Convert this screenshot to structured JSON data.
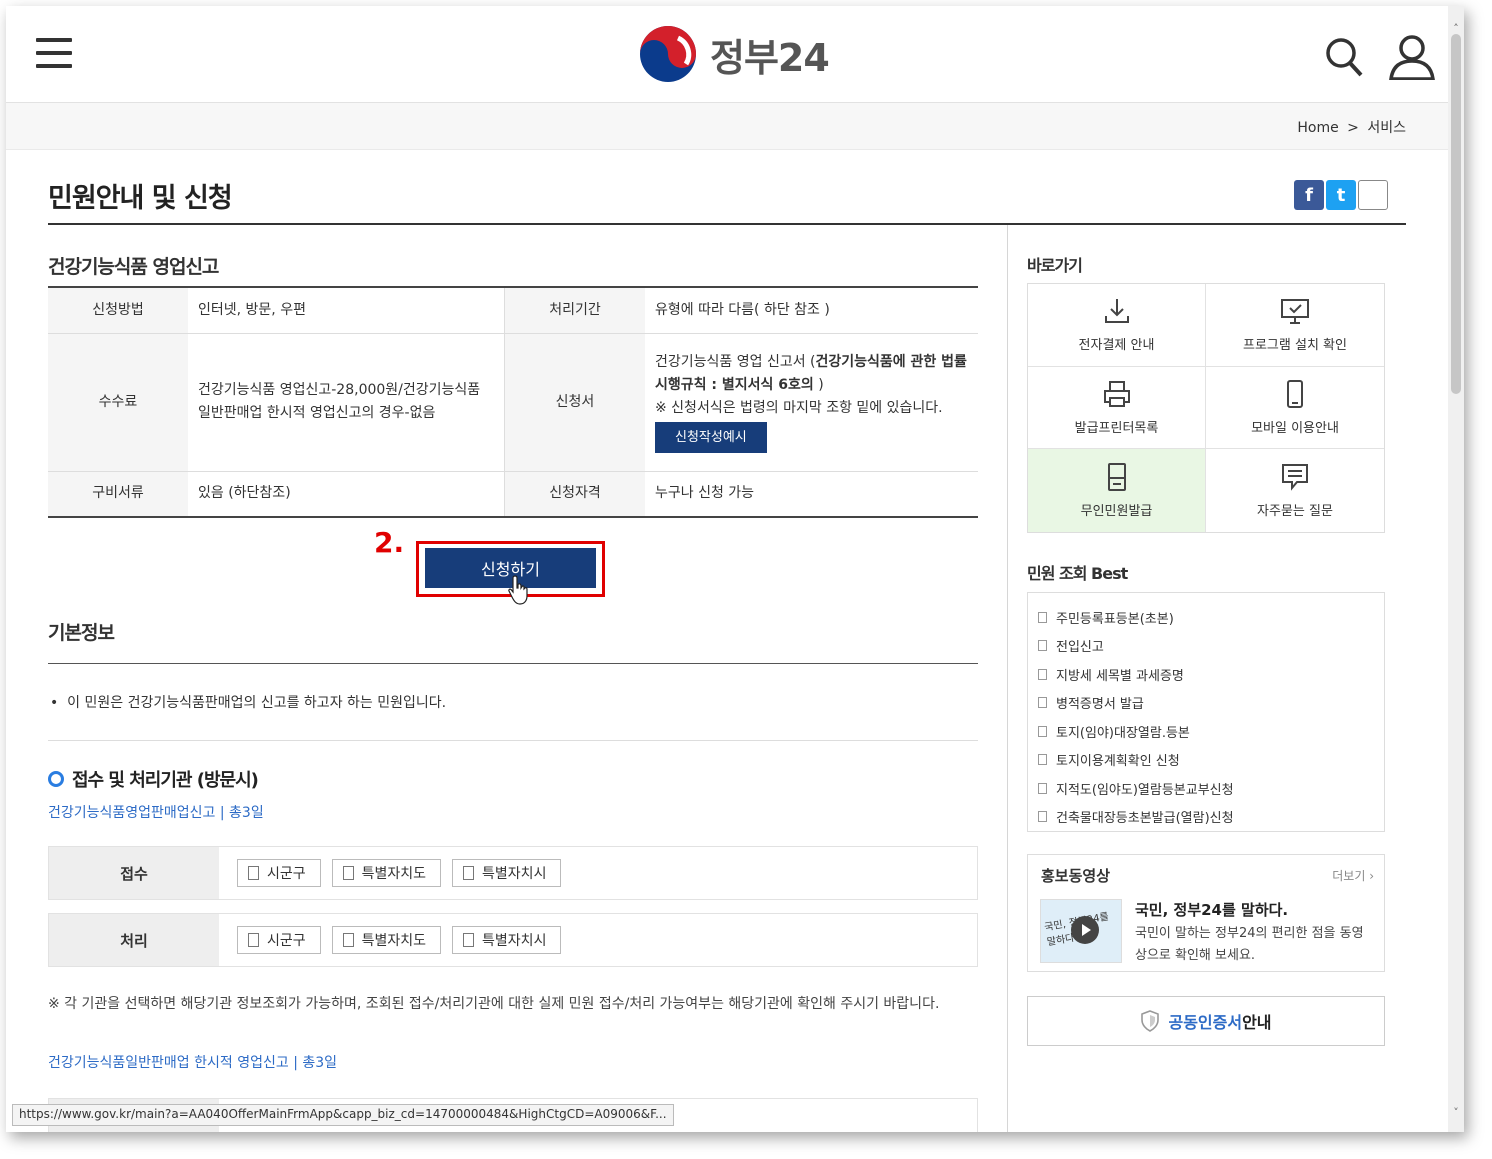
{
  "header": {
    "logo_text": "정부24",
    "menu_icon": "hamburger-icon",
    "search_icon": "search-icon",
    "user_icon": "user-icon"
  },
  "breadcrumb": {
    "home": "Home",
    "sep": ">",
    "current": "서비스"
  },
  "page": {
    "title": "민원안내 및 신청",
    "share": {
      "facebook": "f",
      "twitter": "t",
      "print": "⎙"
    }
  },
  "service": {
    "title": "건강기능식품 영업신고",
    "rows": [
      {
        "h1": "신청방법",
        "v1": "인터넷, 방문, 우편",
        "h2": "처리기간",
        "v2": "유형에 따라 다름( 하단 참조 )"
      },
      {
        "h1": "수수료",
        "v1": "건강기능식품 영업신고-28,000원/건강기능식품 일반판매업 한시적 영업신고의 경우-없음",
        "h2": "신청서",
        "v2_a": "건강기능식품 영업 신고서 (",
        "v2_b": "건강기능식품에 관한 법률 시행규칙 : 별지서식 6호의",
        "v2_c": " )",
        "v2_note": "※ 신청서식은 법령의 마지막 조항 밑에 있습니다.",
        "sample_button": "신청작성예시"
      },
      {
        "h1": "구비서류",
        "v1": "있음 (하단참조)",
        "h2": "신청자격",
        "v2": "누구나 신청 가능"
      }
    ]
  },
  "apply": {
    "step_label": "2.",
    "button": "신청하기"
  },
  "basic": {
    "title": "기본정보",
    "text": "이 민원은 건강기능식품판매업의 신고를 하고자 하는 민원입니다."
  },
  "org": {
    "title": "접수 및 처리기관 (방문시)",
    "subtitle": "건강기능식품영업판매업신고 | 총3일",
    "rows": [
      {
        "label": "접수",
        "chips": [
          "시군구",
          "특별자치도",
          "특별자치시"
        ]
      },
      {
        "label": "처리",
        "chips": [
          "시군구",
          "특별자치도",
          "특별자치시"
        ]
      }
    ],
    "note": "※ 각 기관을 선택하면 해당기관 정보조회가 가능하며, 조회된 접수/처리기관에 대한 실제 민원 접수/처리 가능여부는 해당기관에 확인해 주시기 바랍니다.",
    "subtitle2": "건강기능식품일반판매업 한시적 영업신고 | 총3일"
  },
  "status_url": "https://www.gov.kr/main?a=AA040OfferMainFrmApp&capp_biz_cd=14700000484&HighCtgCD=A09006&F...",
  "sidebar": {
    "shortcuts_title": "바로가기",
    "shortcuts": [
      {
        "label": "전자결제 안내",
        "icon": "download-icon"
      },
      {
        "label": "프로그램 설치 확인",
        "icon": "monitor-check-icon"
      },
      {
        "label": "발급프린터목록",
        "icon": "printer-icon"
      },
      {
        "label": "모바일 이용안내",
        "icon": "mobile-icon"
      },
      {
        "label": "무인민원발급",
        "icon": "kiosk-icon"
      },
      {
        "label": "자주묻는 질문",
        "icon": "chat-icon"
      }
    ],
    "best_title": "민원 조회 Best",
    "best": [
      "주민등록표등본(초본)",
      "전입신고",
      "지방세 세목별 과세증명",
      "병적증명서 발급",
      "토지(임야)대장열람.등본",
      "토지이용계획확인 신청",
      "지적도(임야도)열람등본교부신청",
      "건축물대장등초본발급(열람)신청"
    ],
    "video": {
      "title": "홍보동영상",
      "more": "더보기 ›",
      "thumb_text": "국민, 정부24를 말하다",
      "headline": "국민, 정부24를 말하다.",
      "desc": "국민이 말하는 정부24의 편리한 점을 동영상으로 확인해 보세요."
    },
    "cert": {
      "blue": "공동인증서",
      "rest": " 안내"
    }
  },
  "colors": {
    "navy": "#173d7a",
    "red": "#e00000",
    "link": "#2d6bc6",
    "kiosk_bg": "#e9f7e4"
  }
}
